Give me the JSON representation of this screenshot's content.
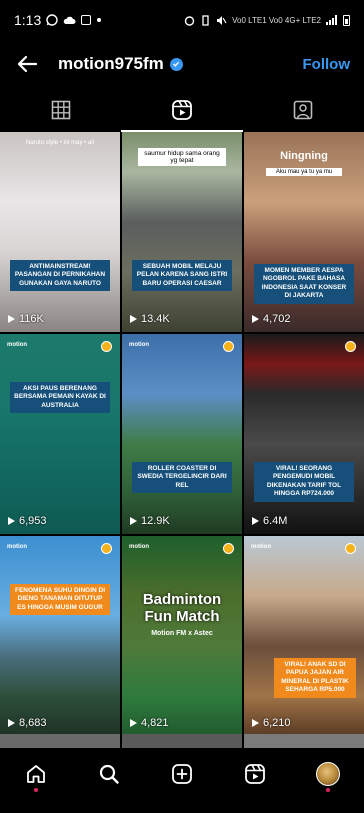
{
  "status": {
    "time": "1:13",
    "right": "Vo0 LTE1 Vo0 4G+ LTE2"
  },
  "header": {
    "username": "motion975fm",
    "follow": "Follow"
  },
  "tabs": [
    {
      "icon": "grid-icon",
      "active": false
    },
    {
      "icon": "reels-icon",
      "active": true
    },
    {
      "icon": "tagged-icon",
      "active": false
    }
  ],
  "tiles": [
    {
      "top_text": "Naruto style • ini may • all",
      "caption": "ANTIMAINSTREAM! PASANGAN DI PERNIKAHAN GUNAKAN GAYA NARUTO",
      "views": "116K"
    },
    {
      "top_text": "saumur hidup sama orang yg tepat",
      "caption": "SEBUAH MOBIL MELAJU PELAN KARENA SANG ISTRI BARU OPERASI CAESAR",
      "views": "13.4K"
    },
    {
      "top_text": "Ningning",
      "subtitle": "Aku mau ya tu ya mu",
      "caption": "MOMEN MEMBER AESPA NGOBROL PAKE BAHASA INDONESIA SAAT KONSER DI JAKARTA",
      "views": "4,702"
    },
    {
      "caption": "AKSI PAUS BERENANG BERSAMA PEMAIN KAYAK DI AUSTRALIA",
      "views": "6,953"
    },
    {
      "caption": "ROLLER COASTER DI SWEDIA TERGELINCIR DARI REL",
      "views": "12.9K"
    },
    {
      "caption": "VIRAL! SEORANG PENGEMUDI MOBIL DIKENAKAN TARIF TOL HINGGA RP724.000",
      "views": "6.4M"
    },
    {
      "caption": "FENOMENA SUHU DINGIN DI DIENG TANAMAN DITUTUP ES HINGGA MUSIM GUGUR",
      "views": "8,683"
    },
    {
      "top_text": "Badminton Fun Match",
      "subtitle": "Motion FM x Astec",
      "views": "4,821"
    },
    {
      "caption": "VIRAL! ANAK SD DI PAPUA JAJAN AIR MINERAL DI PLASTIK SEHARGA RP5.000",
      "views": "6,210"
    }
  ],
  "brand_label": "motion",
  "colors": {
    "accent": "#3897f0",
    "caption_bg": "#16507a",
    "notification": "#e0245e"
  },
  "nav": [
    "home-icon",
    "search-icon",
    "create-icon",
    "reels-icon",
    "profile-avatar"
  ]
}
